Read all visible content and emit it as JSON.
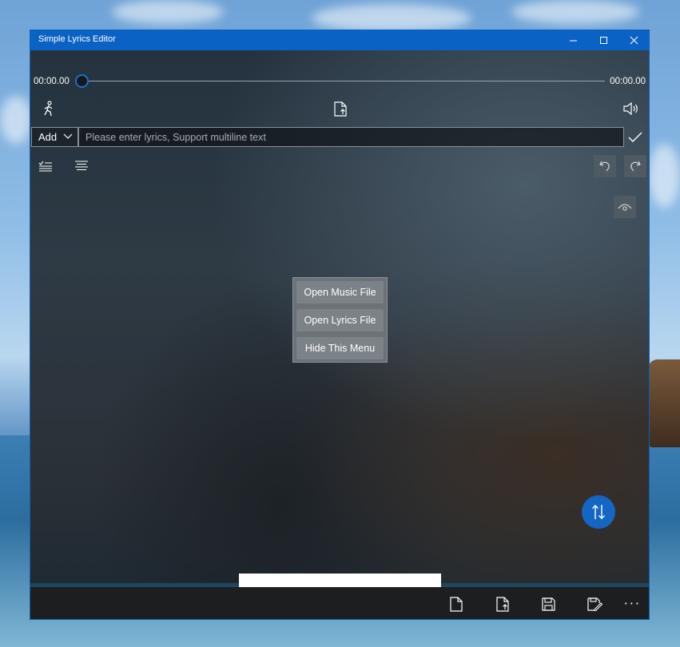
{
  "window": {
    "title": "Simple Lyrics Editor"
  },
  "titlebar_buttons": [
    {
      "name": "minimize",
      "glyph": "—"
    },
    {
      "name": "maximize",
      "glyph": "☐"
    },
    {
      "name": "close",
      "glyph": "✕"
    }
  ],
  "player": {
    "current_time": "00:00.00",
    "total_time": "00:00.00",
    "progress": 0
  },
  "toolbar": {
    "left_icon": "walking-person-icon",
    "center_icon": "open-file-icon",
    "right_icon": "volume-icon"
  },
  "input_row": {
    "mode": "Add",
    "placeholder": "Please enter lyrics, Support multiline text",
    "value": "",
    "confirm_icon": "checkmark-icon"
  },
  "list_tools": {
    "left_icons": [
      "checklist-icon",
      "align-lines-icon"
    ],
    "undo_icon": "undo-icon",
    "redo_icon": "redo-icon",
    "preview_icon": "eye-icon"
  },
  "menu": {
    "items": [
      "Open Music File",
      "Open Lyrics File",
      "Hide This Menu"
    ]
  },
  "fab": {
    "icon": "swap-vertical-icon"
  },
  "bottom_bar": {
    "icons": [
      "new-file-icon",
      "open-file-icon",
      "save-icon",
      "save-as-icon"
    ],
    "more": "···"
  },
  "colors": {
    "accent": "#0a63c4",
    "fab": "#1466c2"
  }
}
